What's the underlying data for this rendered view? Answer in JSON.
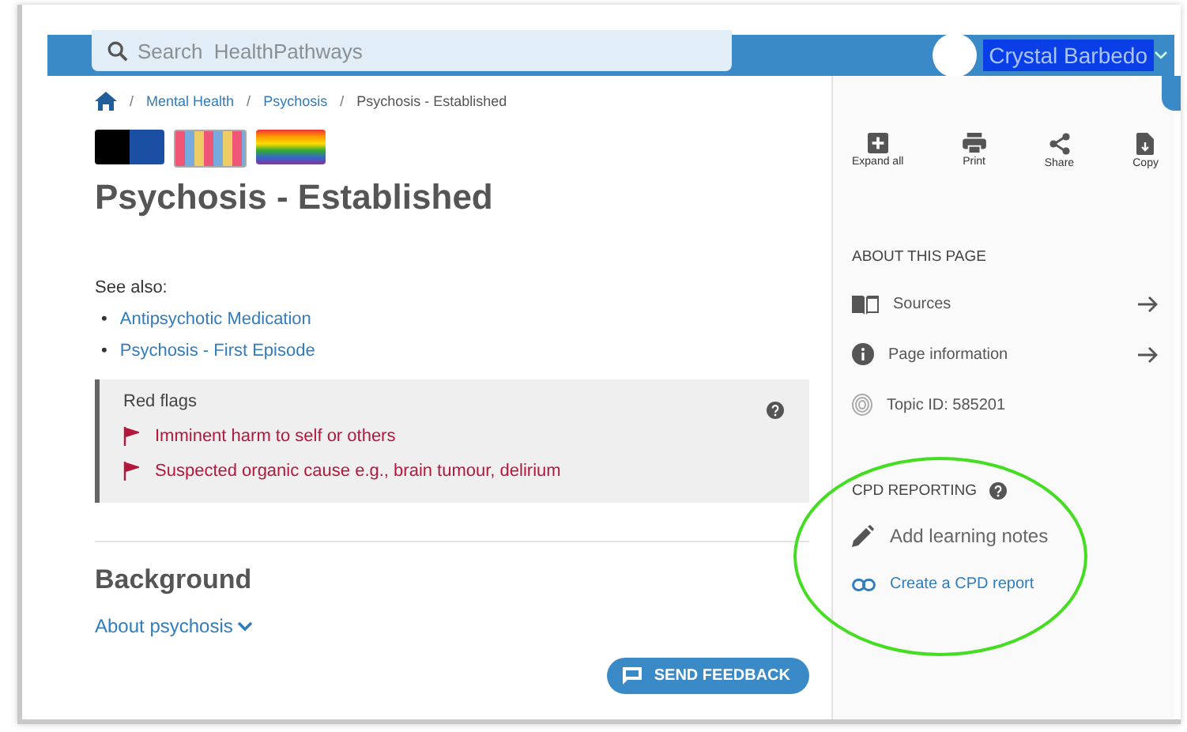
{
  "header": {
    "search": {
      "placeholder": "Search  HealthPathways"
    },
    "user_name": "Crystal Barbedo"
  },
  "breadcrumbs": [
    "Mental Health",
    "Psychosis",
    "Psychosis - Established"
  ],
  "breadcrumb_separator": "/",
  "bullet": "•",
  "title": "Psychosis - Established",
  "see_also": {
    "label": "See also:",
    "links": [
      "Antipsychotic Medication",
      "Psychosis - First Episode"
    ]
  },
  "red_flags": {
    "title": "Red flags",
    "items": [
      "Imminent harm to self or others",
      "Suspected organic cause e.g., brain tumour, delirium"
    ]
  },
  "background": {
    "heading": "Background",
    "toggle": "About psychosis",
    "expanded": false
  },
  "feedback_button": "SEND FEEDBACK",
  "toolbar": [
    {
      "kind": "expand",
      "label": "Expand all"
    },
    {
      "kind": "print",
      "label": "Print"
    },
    {
      "kind": "share",
      "label": "Share"
    },
    {
      "kind": "copy",
      "label": "Copy"
    }
  ],
  "about": {
    "heading": "ABOUT THIS PAGE",
    "items": [
      {
        "kind": "sources",
        "label": "Sources"
      },
      {
        "kind": "info",
        "label": "Page information"
      },
      {
        "kind": "topic",
        "label": "Topic ID: 585201"
      }
    ]
  },
  "cpd": {
    "heading": "CPD REPORTING",
    "notes": "Add learning notes",
    "report": "Create a CPD report"
  }
}
